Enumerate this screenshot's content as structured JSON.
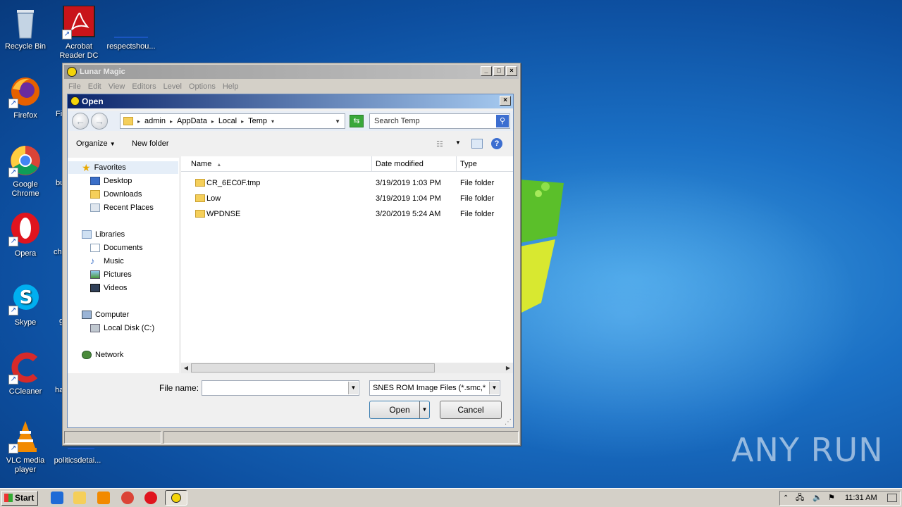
{
  "desktop": {
    "icons": [
      {
        "label": "Recycle Bin",
        "icon": "recycle-bin-icon"
      },
      {
        "label": "Acrobat Reader DC",
        "icon": "acrobat-icon"
      },
      {
        "label": "respectshou...",
        "icon": "file-icon"
      },
      {
        "label": "Firefox",
        "icon": "firefox-icon"
      },
      {
        "label": "Google Chrome",
        "icon": "chrome-icon"
      },
      {
        "label": "Opera",
        "icon": "opera-icon"
      },
      {
        "label": "Skype",
        "icon": "skype-icon"
      },
      {
        "label": "CCleaner",
        "icon": "ccleaner-icon"
      },
      {
        "label": "VLC media player",
        "icon": "vlc-icon"
      },
      {
        "label": "politicsdetai...",
        "icon": "file-icon"
      }
    ],
    "partial_labels": [
      "Fi",
      "bu",
      "ch",
      "g",
      "ha"
    ],
    "watermark": "ANY RUN"
  },
  "lunar_magic": {
    "title": "Lunar Magic",
    "menu": [
      "File",
      "Edit",
      "View",
      "Editors",
      "Level",
      "Options",
      "Help"
    ]
  },
  "dialog": {
    "title": "Open",
    "breadcrumb": [
      "admin",
      "AppData",
      "Local",
      "Temp"
    ],
    "search_placeholder": "Search Temp",
    "organize": "Organize",
    "new_folder": "New folder",
    "nav": {
      "favorites": "Favorites",
      "favorites_items": [
        "Desktop",
        "Downloads",
        "Recent Places"
      ],
      "libraries": "Libraries",
      "libraries_items": [
        "Documents",
        "Music",
        "Pictures",
        "Videos"
      ],
      "computer": "Computer",
      "computer_items": [
        "Local Disk (C:)"
      ],
      "network": "Network"
    },
    "columns": [
      "Name",
      "Date modified",
      "Type"
    ],
    "files": [
      {
        "name": "CR_6EC0F.tmp",
        "date": "3/19/2019 1:03 PM",
        "type": "File folder"
      },
      {
        "name": "Low",
        "date": "3/19/2019 1:04 PM",
        "type": "File folder"
      },
      {
        "name": "WPDNSE",
        "date": "3/20/2019 5:24 AM",
        "type": "File folder"
      }
    ],
    "file_name_label": "File name:",
    "file_name_value": "",
    "filter": "SNES ROM Image Files (*.smc,*",
    "open_button": "Open",
    "cancel_button": "Cancel"
  },
  "taskbar": {
    "start": "Start",
    "clock": "11:31 AM"
  }
}
